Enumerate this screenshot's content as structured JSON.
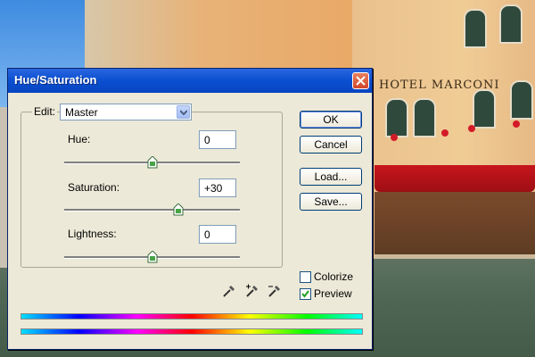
{
  "window": {
    "title": "Hue/Saturation"
  },
  "background": {
    "sign_text": "HOTEL MARCONI"
  },
  "edit": {
    "label": "Edit:",
    "selected": "Master"
  },
  "sliders": [
    {
      "label": "Hue:",
      "value": "0",
      "level": 0.5
    },
    {
      "label": "Saturation:",
      "value": "+30",
      "level": 0.65
    },
    {
      "label": "Lightness:",
      "value": "0",
      "level": 0.5
    }
  ],
  "buttons": {
    "ok": "OK",
    "cancel": "Cancel",
    "load": "Load...",
    "save": "Save..."
  },
  "options": {
    "colorize": {
      "label": "Colorize",
      "checked": false
    },
    "preview": {
      "label": "Preview",
      "checked": true
    }
  },
  "icons": [
    "eyedropper-icon",
    "eyedropper-plus-icon",
    "eyedropper-minus-icon",
    "close-icon",
    "chevron-down-icon"
  ],
  "colors": {
    "titlebar": "#0a4fd0",
    "dialog_bg": "#ece9d8",
    "close_button": "#d2462a"
  }
}
